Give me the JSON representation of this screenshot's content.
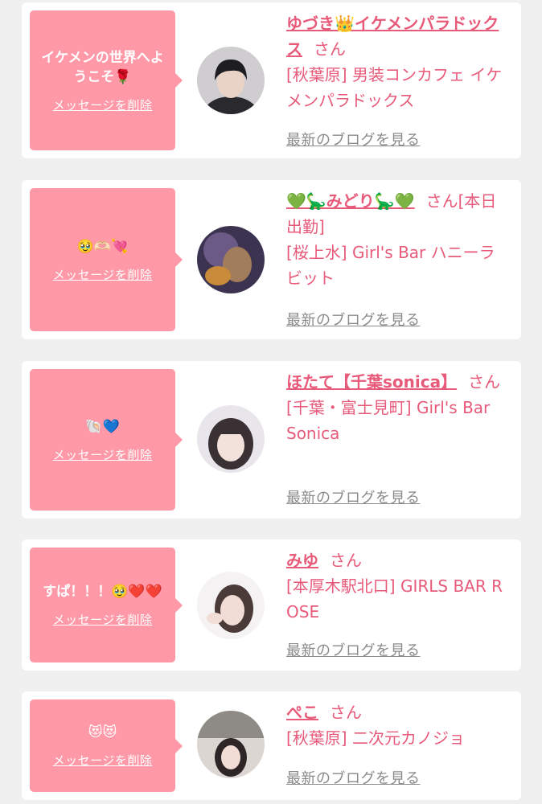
{
  "colors": {
    "accent": "#e85a7a",
    "bubble": "#ff99a8",
    "background": "#f0f0f0",
    "card": "#ffffff",
    "link_gray": "#8a8a8a"
  },
  "items": [
    {
      "message": "イケメンの世界へようこそ🌹",
      "delete_label": "メッセージを削除",
      "name": "ゆづき👑イケメンパラドックス",
      "suffix": "さん",
      "shop": "[秋葉原] 男装コンカフェ イケメンパラドックス",
      "blog_link": "最新のブログを見る"
    },
    {
      "message": "🥹🫶🏻💘",
      "delete_label": "メッセージを削除",
      "name": "💚🦕みどり🦕💚",
      "suffix": "さん[本日出勤]",
      "shop": "[桜上水] Girl's Bar ハニーラビット",
      "blog_link": "最新のブログを見る"
    },
    {
      "message": "🐚💙",
      "delete_label": "メッセージを削除",
      "name": "ほたて【千葉sonica】",
      "suffix": "さん",
      "shop": "[千葉・富士見町] Girl's Bar Sonica",
      "blog_link": "最新のブログを見る"
    },
    {
      "message": "すぱ！！！🥹❤️❤️",
      "delete_label": "メッセージを削除",
      "name": "みゆ",
      "suffix": "さん",
      "shop": "[本厚木駅北口] GIRLS BAR ROSE",
      "blog_link": "最新のブログを見る"
    },
    {
      "message": "😻😻",
      "delete_label": "メッセージを削除",
      "name": "ぺこ",
      "suffix": "さん",
      "shop": "[秋葉原] 二次元カノジョ",
      "blog_link": "最新のブログを見る"
    }
  ]
}
